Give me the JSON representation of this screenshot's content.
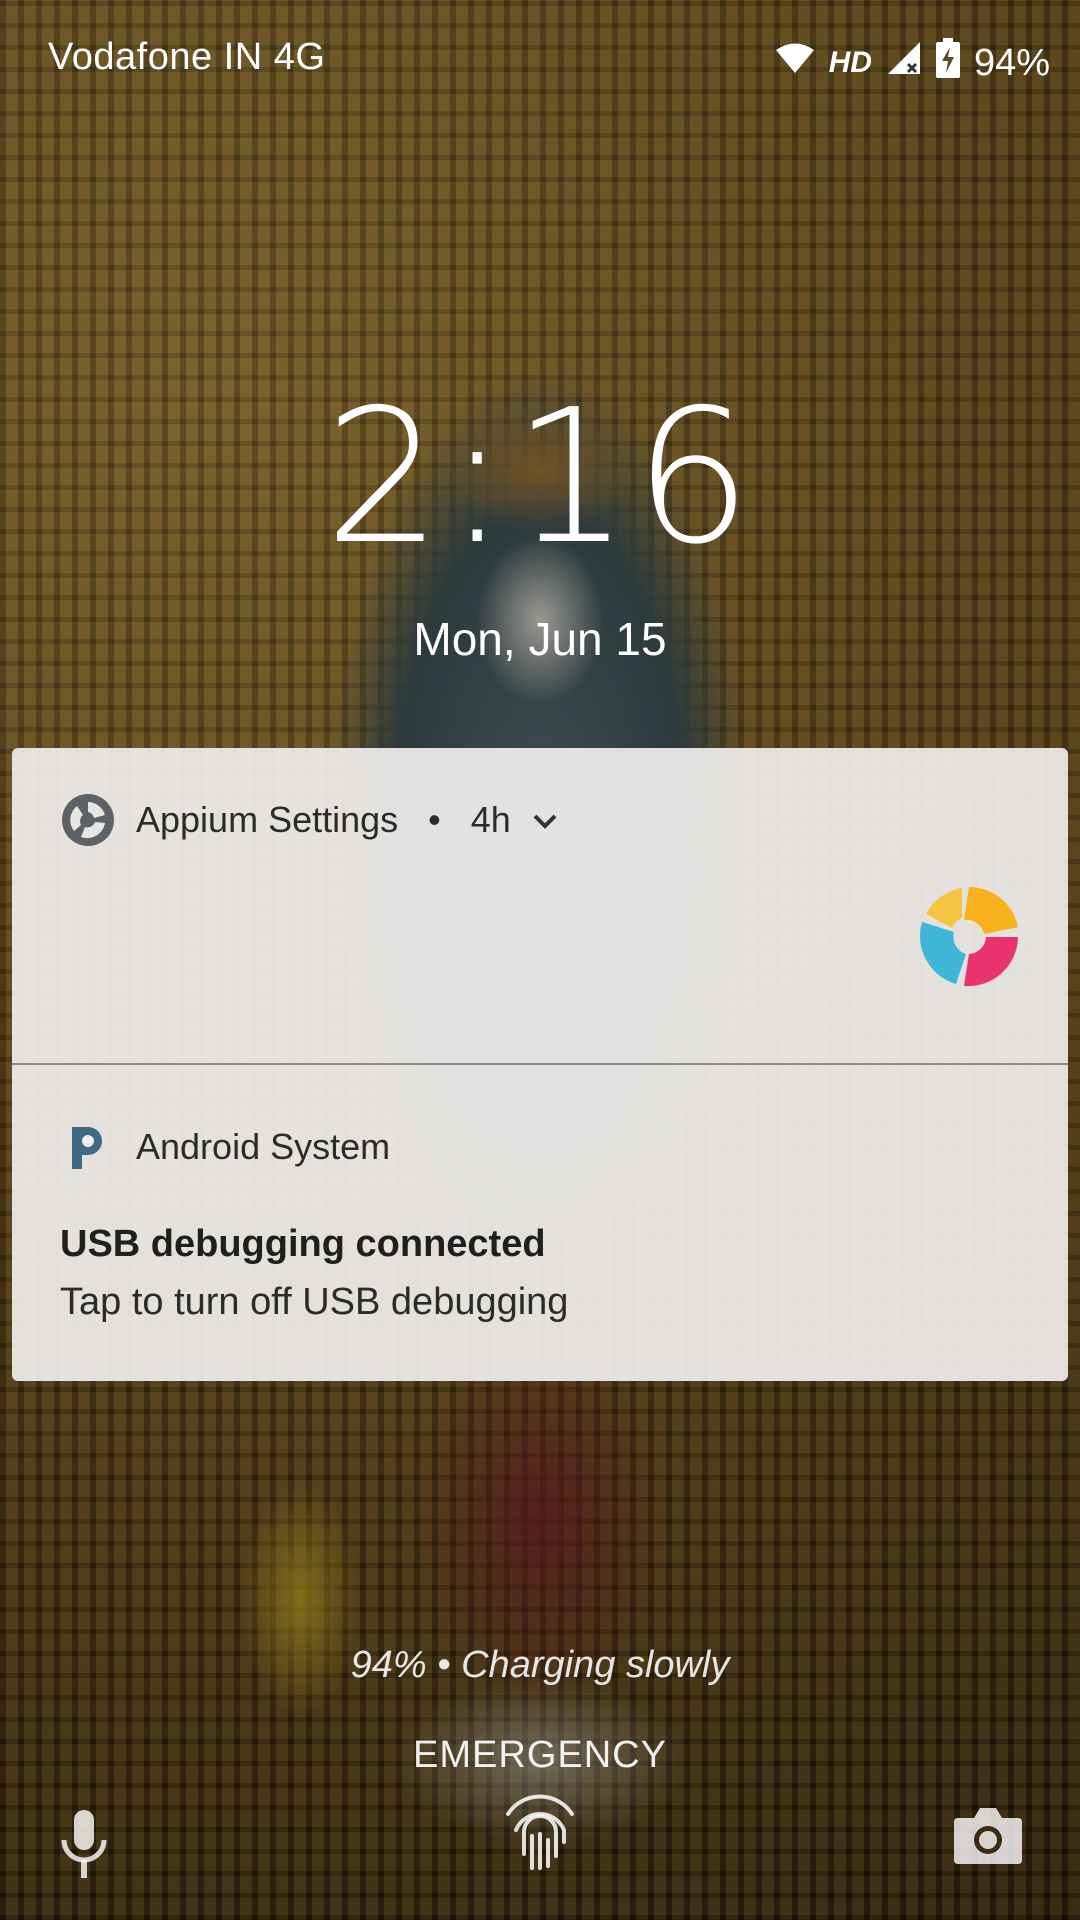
{
  "status_bar": {
    "carrier": "Vodafone IN 4G",
    "hd": "HD",
    "battery": "94%",
    "icons": [
      "wifi-icon",
      "signal-icon",
      "battery-charging-icon"
    ]
  },
  "lockscreen": {
    "time": "2:16",
    "date": "Mon, Jun 15"
  },
  "notifications": [
    {
      "app": "Appium Settings",
      "separator": "•",
      "time": "4h",
      "icon": "appium-icon",
      "large_icon": "appium-logo"
    },
    {
      "app": "Android System",
      "icon": "android-p-icon",
      "title": "USB debugging connected",
      "text": "Tap to turn off USB debugging"
    }
  ],
  "bottom": {
    "charging": "94% • Charging slowly",
    "emergency": "EMERGENCY",
    "left_icon": "mic-icon",
    "center_icon": "fingerprint-icon",
    "right_icon": "camera-icon"
  },
  "colors": {
    "notification_bg": "#F0EEEC",
    "appium_yellow": "#F7B21E",
    "appium_pink": "#E8336F",
    "appium_blue": "#3FB6D7",
    "android_p_blue": "#3E6A84"
  }
}
